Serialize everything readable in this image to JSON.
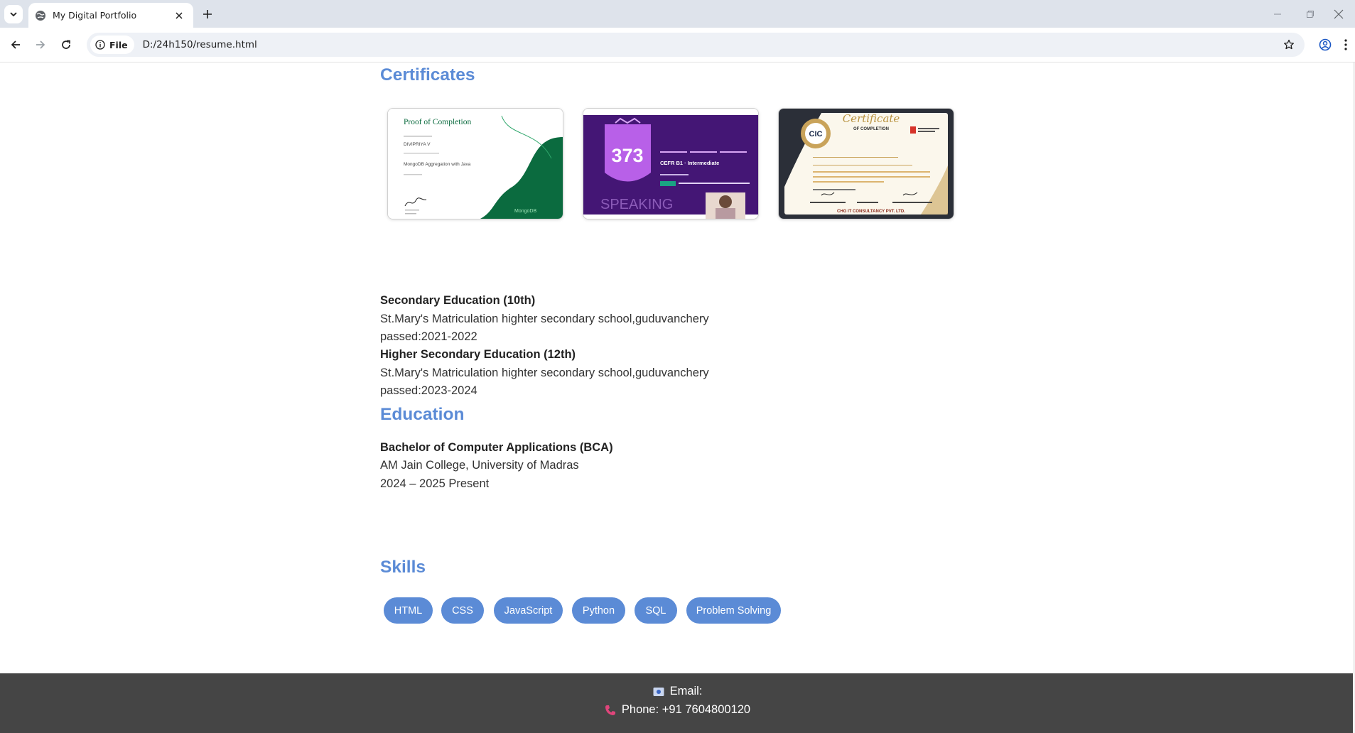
{
  "browser": {
    "tab_title": "My Digital Portfolio",
    "url_chip": "File",
    "url": "D:/24h150/resume.html"
  },
  "certificates": {
    "heading": "Certificates",
    "cards": [
      {
        "title": "Proof of Completion",
        "name": "DIVIPRIYA V",
        "course": "MongoDB Aggregation with Java",
        "brand": "MongoDB"
      },
      {
        "score": "373",
        "level": "CEFR B1 · Intermediate",
        "skill": "SPEAKING"
      },
      {
        "title": "Certificate",
        "subtitle": "OF COMPLETION",
        "badge": "CIC",
        "company": "CHG IT CONSULTANCY PVT. LTD."
      }
    ]
  },
  "schooling": [
    {
      "title": "Secondary Education (10th)",
      "school": "St.Mary's Matriculation highter secondary school,guduvanchery",
      "passed": "passed:2021-2022"
    },
    {
      "title": "Higher Secondary Education (12th)",
      "school": "St.Mary's Matriculation highter secondary school,guduvanchery",
      "passed": "passed:2023-2024"
    }
  ],
  "education": {
    "heading": "Education",
    "degree": "Bachelor of Computer Applications (BCA)",
    "college": "AM Jain College, University of Madras",
    "years": "2024 – 2025 Present"
  },
  "skills": {
    "heading": "Skills",
    "items": [
      "HTML",
      "CSS",
      "JavaScript",
      "Python",
      "SQL",
      "Problem Solving"
    ]
  },
  "footer": {
    "email_label": "Email:",
    "phone_label": "Phone: +91 7604800120"
  },
  "colors": {
    "accent": "#5b8bd6",
    "footer_bg": "#454545"
  }
}
